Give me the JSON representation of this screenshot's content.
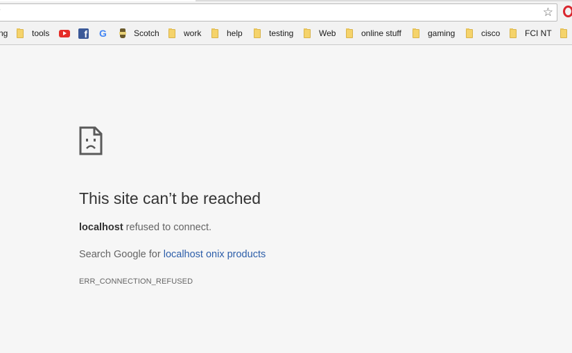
{
  "browser": {
    "address_bar": {
      "url": "/"
    },
    "bookmarks": [
      {
        "label": "ng",
        "icon": "folder-icon"
      },
      {
        "label": "tools",
        "icon": "folder-icon"
      },
      {
        "label": "",
        "icon": "youtube-icon"
      },
      {
        "label": "",
        "icon": "facebook-icon"
      },
      {
        "label": "",
        "icon": "google-icon"
      },
      {
        "label": "Scotch",
        "icon": "scotch-icon"
      },
      {
        "label": "work",
        "icon": "folder-icon"
      },
      {
        "label": "help",
        "icon": "folder-icon"
      },
      {
        "label": "testing",
        "icon": "folder-icon"
      },
      {
        "label": "Web",
        "icon": "folder-icon"
      },
      {
        "label": "online stuff",
        "icon": "folder-icon"
      },
      {
        "label": "gaming",
        "icon": "folder-icon"
      },
      {
        "label": "cisco",
        "icon": "folder-icon"
      },
      {
        "label": "FCI NT",
        "icon": "folder-icon"
      }
    ]
  },
  "error_page": {
    "title": "This site can’t be reached",
    "host": "localhost",
    "refused_text": " refused to connect.",
    "search_prefix": "Search Google for ",
    "search_link": "localhost onix products",
    "error_code": "ERR_CONNECTION_REFUSED"
  },
  "colors": {
    "page_background": "#f6f6f6",
    "link": "#2d5ea9",
    "title": "#333333",
    "body_text": "#646464",
    "folder": "#f5d36b"
  }
}
